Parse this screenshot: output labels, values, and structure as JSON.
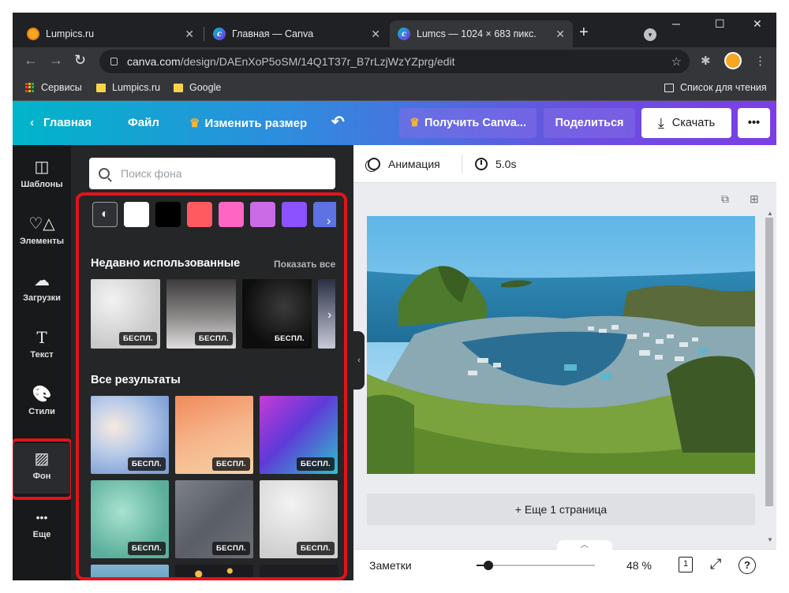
{
  "browser": {
    "tabs": [
      {
        "title": "Lumpics.ru",
        "favicon": "lumpics-orange-icon"
      },
      {
        "title": "Главная — Canva",
        "favicon": "canva-icon"
      },
      {
        "title": "Lumcs — 1024 × 683 пикс.",
        "favicon": "canva-icon"
      }
    ],
    "tab_close_glyph": "✕",
    "new_tab_glyph": "+",
    "window_controls": [
      "─",
      "☐",
      "✕"
    ],
    "url_host": "canva.com",
    "url_path": "/design/DAEnXoP5oSM/14Q1T37r_B7rLzjWzYZprg/edit",
    "bookmarks": [
      "Сервисы",
      "Lumpics.ru",
      "Google"
    ],
    "reading_list": "Список для чтения"
  },
  "header": {
    "home": "Главная",
    "file": "Файл",
    "resize": "Изменить размер",
    "get_pro": "Получить Canva...",
    "share": "Поделиться",
    "download": "Скачать",
    "more": "•••"
  },
  "rail": [
    {
      "label": "Шаблоны",
      "icon": "templates-icon",
      "glyph": "◫"
    },
    {
      "label": "Элементы",
      "icon": "elements-icon",
      "glyph": "♡△"
    },
    {
      "label": "Загрузки",
      "icon": "upload-cloud-icon",
      "glyph": "☁"
    },
    {
      "label": "Текст",
      "icon": "text-icon",
      "glyph": "T"
    },
    {
      "label": "Стили",
      "icon": "styles-palette-icon",
      "glyph": "🎨"
    },
    {
      "label": "Фон",
      "icon": "background-hatch-icon",
      "glyph": "▨"
    },
    {
      "label": "Еще",
      "icon": "more-dots-icon",
      "glyph": "•••"
    }
  ],
  "panel": {
    "search_placeholder": "Поиск фона",
    "swatch_colors": [
      "#ffffff",
      "#000000",
      "#ff5a5f",
      "#ff66c4",
      "#cb6ce6",
      "#8c52ff",
      "#5e72e4"
    ],
    "recent_title": "Недавно использованные",
    "show_all": "Показать все",
    "all_results_title": "Все результаты",
    "badge": "БЕСПЛ."
  },
  "workspace": {
    "animation": "Анимация",
    "duration": "5.0s",
    "add_page": "+ Еще 1 страница",
    "notes": "Заметки",
    "zoom": "48 %",
    "zoom_fraction": 0.1,
    "page_number": "1",
    "help": "?"
  }
}
